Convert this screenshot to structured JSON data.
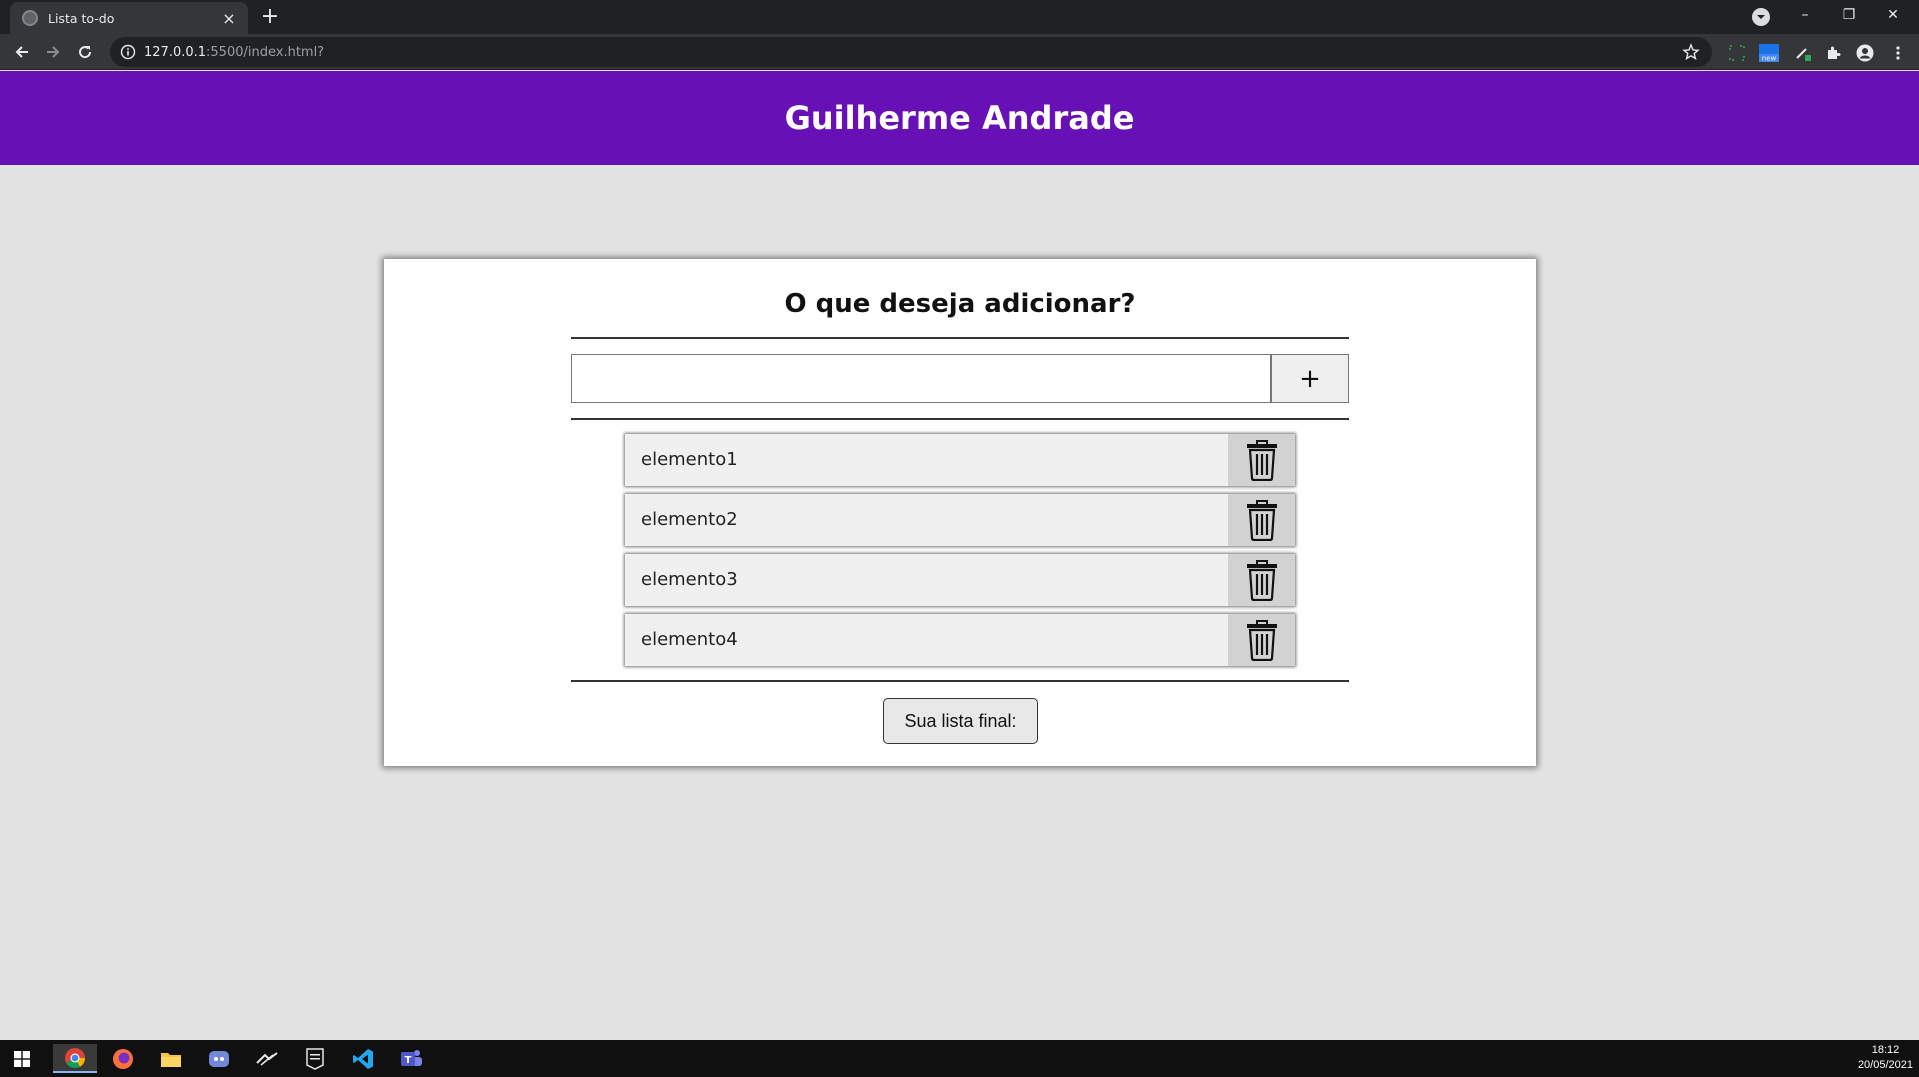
{
  "browser": {
    "tab_title": "Lista to-do",
    "tab_close": "×",
    "new_tab": "+",
    "url_host": "127.0.0.1",
    "url_rest": ":5500/index.html?",
    "window_controls": {
      "minimize": "–",
      "restore": "❐",
      "close": "✕"
    }
  },
  "page": {
    "header_title": "Guilherme Andrade",
    "card_title": "O que deseja adicionar?",
    "input_value": "",
    "add_button_label": "+",
    "items": [
      {
        "label": "elemento1"
      },
      {
        "label": "elemento2"
      },
      {
        "label": "elemento3"
      },
      {
        "label": "elemento4"
      }
    ],
    "final_button_label": "Sua lista final:"
  },
  "taskbar": {
    "time": "18:12",
    "date": "20/05/2021"
  },
  "colors": {
    "header_bg": "#6610b6",
    "page_bg": "#e2e2e2",
    "chrome_dark": "#202124",
    "chrome_toolbar": "#35363a"
  }
}
